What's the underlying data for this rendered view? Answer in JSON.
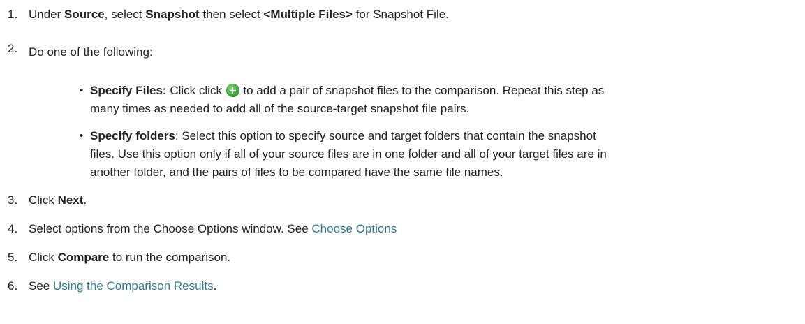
{
  "steps": [
    {
      "number": "1.",
      "parts": [
        "Under ",
        "Source",
        ", select ",
        "Snapshot",
        " then select ",
        "<Multiple Files>",
        " for Snapshot File."
      ]
    },
    {
      "number": "2.",
      "text": "Do one of the following:",
      "bullets": [
        {
          "lead": "Specify Files:",
          "line1_pre": " Click click ",
          "icon": "add-icon",
          "line1_post": " to add a pair of snapshot files to the comparison. Repeat this step as",
          "line2": "many times as needed to add all of the source-target snapshot file pairs."
        },
        {
          "lead": "Specify folders",
          "line1": ": Select this option to specify source and target folders that contain the snapshot",
          "line2": "files. Use this option only if all of your source files are in one folder and all of your target files are in",
          "line3": "another folder, and the pairs of files to be compared have the same file names."
        }
      ]
    },
    {
      "number": "3.",
      "pre": "Click ",
      "bold": "Next",
      "post": "."
    },
    {
      "number": "4.",
      "text": "Select options from the Choose Options window. See ",
      "link": "Choose Options"
    },
    {
      "number": "5.",
      "pre": "Click ",
      "bold": "Compare",
      "post": " to run the comparison."
    },
    {
      "number": "6.",
      "pre": "See ",
      "link": "Using the Comparison Results",
      "post": "."
    }
  ]
}
